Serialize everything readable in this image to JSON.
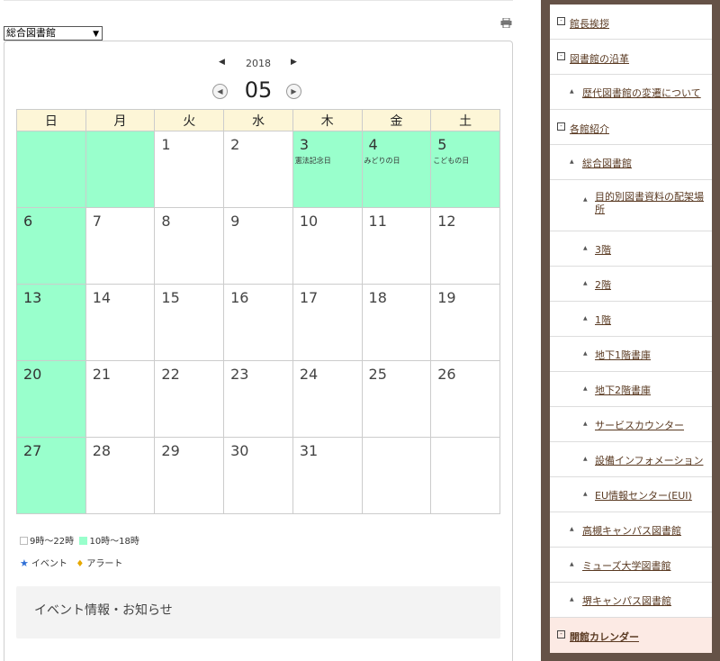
{
  "library_select": {
    "selected": "総合図書館"
  },
  "calendar": {
    "year": "2018",
    "month": "05",
    "weekdays": [
      "日",
      "月",
      "火",
      "水",
      "木",
      "金",
      "土"
    ],
    "weeks": [
      [
        {
          "d": "",
          "closed": true
        },
        {
          "d": "",
          "closed": true
        },
        {
          "d": "1"
        },
        {
          "d": "2"
        },
        {
          "d": "3",
          "closed": true,
          "note": "憲法記念日"
        },
        {
          "d": "4",
          "closed": true,
          "note": "みどりの日"
        },
        {
          "d": "5",
          "closed": true,
          "note": "こどもの日"
        }
      ],
      [
        {
          "d": "6",
          "closed": true
        },
        {
          "d": "7"
        },
        {
          "d": "8"
        },
        {
          "d": "9"
        },
        {
          "d": "10"
        },
        {
          "d": "11"
        },
        {
          "d": "12"
        }
      ],
      [
        {
          "d": "13",
          "closed": true
        },
        {
          "d": "14"
        },
        {
          "d": "15"
        },
        {
          "d": "16"
        },
        {
          "d": "17"
        },
        {
          "d": "18"
        },
        {
          "d": "19"
        }
      ],
      [
        {
          "d": "20",
          "closed": true
        },
        {
          "d": "21"
        },
        {
          "d": "22"
        },
        {
          "d": "23"
        },
        {
          "d": "24"
        },
        {
          "d": "25"
        },
        {
          "d": "26"
        }
      ],
      [
        {
          "d": "27",
          "closed": true
        },
        {
          "d": "28"
        },
        {
          "d": "29"
        },
        {
          "d": "30"
        },
        {
          "d": "31"
        },
        {
          "d": ""
        },
        {
          "d": ""
        }
      ]
    ]
  },
  "legend": {
    "hours_a": "9時～22時",
    "hours_b": "10時～18時",
    "event": "イベント",
    "alert": "アラート"
  },
  "info_box": {
    "title": "イベント情報・お知らせ"
  },
  "colors": {
    "closed": "#99ffcc",
    "header": "#fdf6d7",
    "sidebar_bg": "#655247",
    "active_item": "#fceae4"
  },
  "sidebar": {
    "items": [
      {
        "label": "館長挨拶",
        "level": 0
      },
      {
        "label": "図書館の沿革",
        "level": 0
      },
      {
        "label": "歴代図書館の変遷について",
        "level": 1
      },
      {
        "label": "各館紹介",
        "level": 0
      },
      {
        "label": "総合図書館",
        "level": 1
      },
      {
        "label": "目的別図書資料の配架場所",
        "level": 2,
        "tall": true
      },
      {
        "label": "3階",
        "level": 2
      },
      {
        "label": "2階",
        "level": 2
      },
      {
        "label": "1階",
        "level": 2
      },
      {
        "label": "地下1階書庫",
        "level": 2
      },
      {
        "label": "地下2階書庫",
        "level": 2
      },
      {
        "label": "サービスカウンター",
        "level": 2
      },
      {
        "label": "設備インフォメーション",
        "level": 2
      },
      {
        "label": "EU情報センター(EUI)",
        "level": 2
      },
      {
        "label": "高槻キャンパス図書館",
        "level": 1
      },
      {
        "label": "ミューズ大学図書館",
        "level": 1
      },
      {
        "label": "堺キャンパス図書館",
        "level": 1
      },
      {
        "label": "開館カレンダー",
        "level": 0,
        "active": true
      }
    ]
  }
}
